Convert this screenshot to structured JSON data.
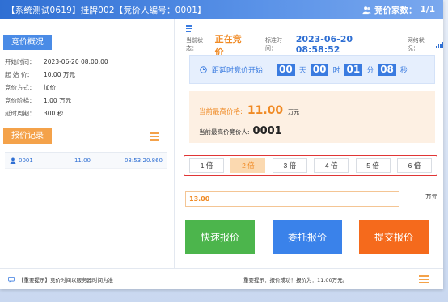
{
  "header": {
    "title": "【系统测试0619】挂牌002【竞价人编号：0001】",
    "bidder_count_label": "竞价家数：",
    "bidder_count": "1/1"
  },
  "overview": {
    "title": "竞价概况",
    "rows": [
      {
        "key": "开始时间：",
        "value": "2023-06-20 08:00:00"
      },
      {
        "key": "起 始 价：",
        "value": "10.00 万元"
      },
      {
        "key": "竞价方式：",
        "value": "加价"
      },
      {
        "key": "竞价阶梯：",
        "value": "1.00 万元"
      },
      {
        "key": "延时周期：",
        "value": "300 秒"
      }
    ]
  },
  "records": {
    "title": "报价记录",
    "rows": [
      {
        "bidder": "0001",
        "price": "11.00",
        "time": "08:53:20.860"
      }
    ]
  },
  "status": {
    "label": "当前状态：",
    "value": "正在竞价",
    "std_time_label": "标准时间：",
    "std_time": "2023-06-20 08:58:52",
    "network_label": "网络状况："
  },
  "countdown": {
    "label": "距延时竞价开始:",
    "days": "00",
    "days_unit": "天",
    "hours": "00",
    "hours_unit": "时",
    "minutes": "01",
    "minutes_unit": "分",
    "seconds": "08",
    "seconds_unit": "秒"
  },
  "price": {
    "highest_label": "当前最高价格:",
    "highest_value": "11.00",
    "highest_unit": "万元",
    "bidder_label": "当前最高价竞价人:",
    "bidder_value": "0001"
  },
  "multipliers": {
    "items": [
      "1 倍",
      "2 倍",
      "3 倍",
      "4 倍",
      "5 倍",
      "6 倍"
    ],
    "active_index": 1
  },
  "bid_input": {
    "value": "13.00",
    "unit": "万元"
  },
  "actions": {
    "quick": "快速报价",
    "entrust": "委托报价",
    "submit": "提交报价"
  },
  "footer": {
    "notice_left": "【重要提示】竞价时间以服务器时间为准",
    "notice_right": "重要提示：报价成功！报价为：11.00万元。"
  },
  "colors": {
    "primary": "#3a7be0",
    "orange": "#f08a24",
    "green": "#4cb54c",
    "submit": "#f56a1c",
    "highlight_border": "#e03535"
  }
}
